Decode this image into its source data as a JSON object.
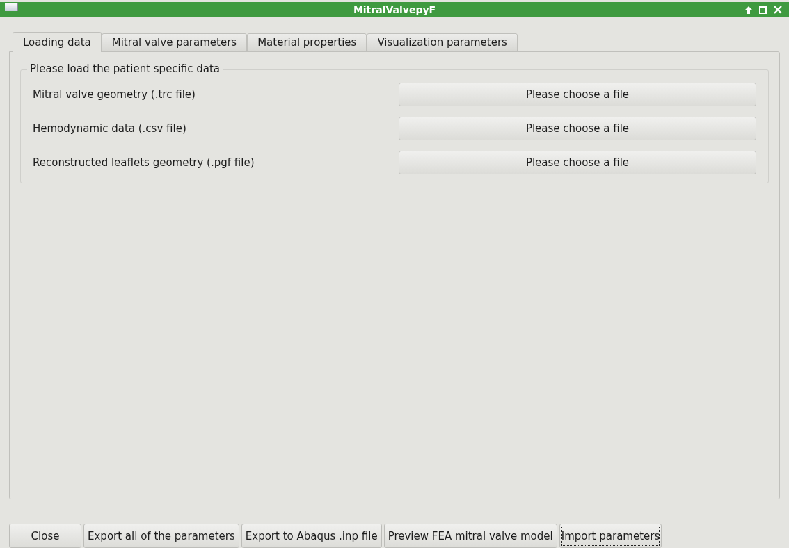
{
  "window": {
    "title": "MitralValvepyF"
  },
  "tabs": [
    {
      "label": "Loading data",
      "selected": true
    },
    {
      "label": "Mitral valve parameters",
      "selected": false
    },
    {
      "label": "Material properties",
      "selected": false
    },
    {
      "label": "Visualization parameters",
      "selected": false
    }
  ],
  "group": {
    "title": "Please load the patient specific data",
    "rows": [
      {
        "label": "Mitral valve geometry (.trc file)",
        "button": "Please choose a file"
      },
      {
        "label": "Hemodynamic data (.csv file)",
        "button": "Please choose a file"
      },
      {
        "label": "Reconstructed leaflets geometry (.pgf file)",
        "button": "Please choose a file"
      }
    ]
  },
  "buttons": [
    {
      "label": "Close",
      "focused": false
    },
    {
      "label": "Export all of the parameters",
      "focused": false
    },
    {
      "label": "Export to Abaqus .inp file",
      "focused": false
    },
    {
      "label": "Preview FEA mitral valve model",
      "focused": false
    },
    {
      "label": "Import parameters",
      "focused": true
    }
  ]
}
